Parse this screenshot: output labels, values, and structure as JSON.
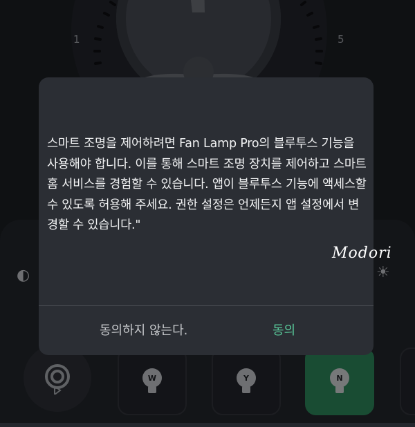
{
  "dial": {
    "label_min": "1",
    "label_max": "5"
  },
  "dialog": {
    "message": "스마트 조명을 제어하려면 Fan Lamp Pro의 블루투스 기능을 사용해야 합니다. 이를 통해 스마트 조명 장치를 제어하고 스마트 홈 서비스를 경험할 수 있습니다. 앱이 블루투스 기능에 액세스할 수 있도록 허용해 주세요. 권한 설정은 언제든지 앱 설정에서 변경할 수 있습니다.\"",
    "deny_label": "동의하지 않는다.",
    "agree_label": "동의",
    "agree_color": "#59c99a"
  },
  "watermark": "Modori",
  "buttons": [
    {
      "icon": "bluetooth-icon"
    },
    {
      "icon": "bulb-icon",
      "letter": "W"
    },
    {
      "icon": "bulb-icon",
      "letter": "Y"
    },
    {
      "icon": "bulb-icon",
      "letter": "N",
      "active": true
    }
  ],
  "accent_color": "#2f8a5e"
}
